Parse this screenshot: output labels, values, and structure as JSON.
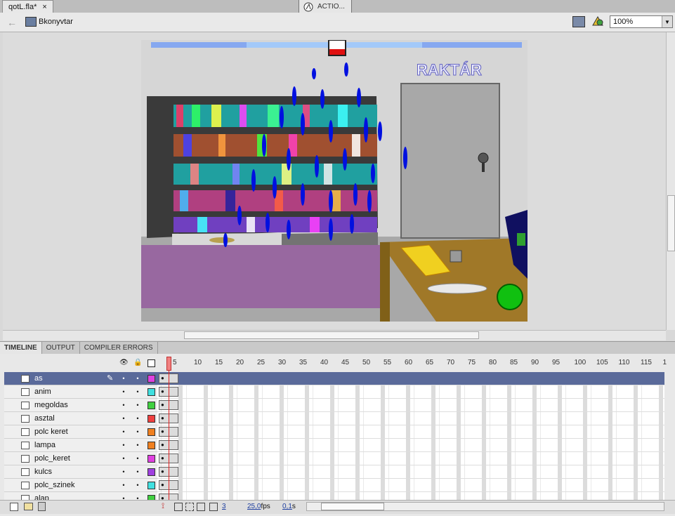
{
  "document": {
    "tab_title": "qotL.fla*",
    "close_glyph": "×"
  },
  "action_panel": {
    "title": "ACTIO..."
  },
  "edit_bar": {
    "scene_label": "Bkonyvtar",
    "zoom_value": "100%"
  },
  "stage": {
    "sign_text": "RAKTÁR"
  },
  "panel_tabs": [
    "TIMELINE",
    "OUTPUT",
    "COMPILER ERRORS"
  ],
  "timeline": {
    "frame_numbers": [
      "5",
      "10",
      "15",
      "20",
      "25",
      "30",
      "35",
      "40",
      "45",
      "50",
      "55",
      "60",
      "65",
      "70",
      "75",
      "80",
      "85",
      "90",
      "95",
      "100",
      "105",
      "110",
      "115",
      "1"
    ],
    "layers": [
      {
        "name": "as",
        "color": "#e040e0",
        "selected": true
      },
      {
        "name": "anim",
        "color": "#40e0e0",
        "selected": false
      },
      {
        "name": "megoldas",
        "color": "#40d040",
        "selected": false
      },
      {
        "name": "asztal",
        "color": "#f04040",
        "selected": false
      },
      {
        "name": "polc keret",
        "color": "#f08020",
        "selected": false
      },
      {
        "name": "lampa",
        "color": "#f08020",
        "selected": false
      },
      {
        "name": "polc_keret",
        "color": "#e040e0",
        "selected": false
      },
      {
        "name": "kulcs",
        "color": "#a040e0",
        "selected": false
      },
      {
        "name": "polc_szinek",
        "color": "#40e0e0",
        "selected": false
      },
      {
        "name": "alap",
        "color": "#40d040",
        "selected": false
      }
    ],
    "footer": {
      "current_frame": "3",
      "fps": "25,0",
      "fps_unit": "fps",
      "elapsed": "0,1",
      "elapsed_unit": "s"
    }
  }
}
